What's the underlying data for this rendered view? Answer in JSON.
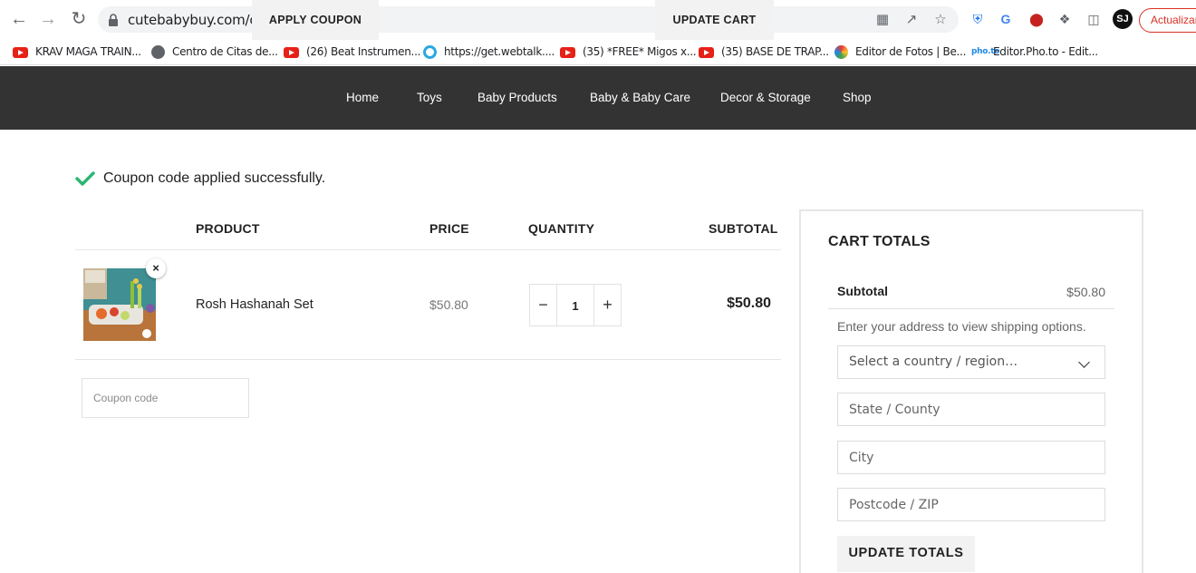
{
  "browser": {
    "url": "cutebabybuy.com/cart/",
    "update_label": "Actualizar",
    "bookmarks": [
      {
        "label": "KRAV MAGA TRAIN...",
        "icon": "youtube-icon"
      },
      {
        "label": "Centro de Citas de...",
        "icon": "globe-icon"
      },
      {
        "label": "(26) Beat Instrumen...",
        "icon": "youtube-icon"
      },
      {
        "label": "https://get.webtalk....",
        "icon": "webtalk-icon"
      },
      {
        "label": "(35) *FREE* Migos x...",
        "icon": "youtube-icon"
      },
      {
        "label": "(35) BASE DE TRAP...",
        "icon": "youtube-icon"
      },
      {
        "label": "Editor de Fotos | Be...",
        "icon": "editor-icon"
      },
      {
        "label": "Editor.Pho.to - Edit...",
        "icon": "phototo-icon"
      }
    ],
    "pho_text": "pho.to"
  },
  "nav": {
    "items": [
      "Home",
      "Toys",
      "Baby Products",
      "Baby & Baby Care",
      "Decor & Storage",
      "Shop"
    ]
  },
  "notice": {
    "message": "Coupon code applied successfully.",
    "color": "#2bb673"
  },
  "cart": {
    "headers": {
      "product": "PRODUCT",
      "price": "PRICE",
      "quantity": "QUANTITY",
      "subtotal": "SUBTOTAL"
    },
    "items": [
      {
        "name": "Rosh Hashanah Set",
        "price": "$50.80",
        "quantity": "1",
        "subtotal": "$50.80",
        "remove_symbol": "×"
      }
    ],
    "coupon_placeholder": "Coupon code",
    "apply_coupon_label": "APPLY COUPON",
    "update_cart_label": "UPDATE CART"
  },
  "totals": {
    "title": "CART TOTALS",
    "subtotal_label": "Subtotal",
    "subtotal_value": "$50.80",
    "shipping_note": "Enter your address to view shipping options.",
    "country_placeholder": "Select a country / region…",
    "state_placeholder": "State / County",
    "city_placeholder": "City",
    "postcode_placeholder": "Postcode / ZIP",
    "update_totals_label": "UPDATE TOTALS"
  },
  "colors": {
    "nav_bg": "#333333",
    "button_bg": "#f2f2f2",
    "accent_red": "#d93025"
  }
}
